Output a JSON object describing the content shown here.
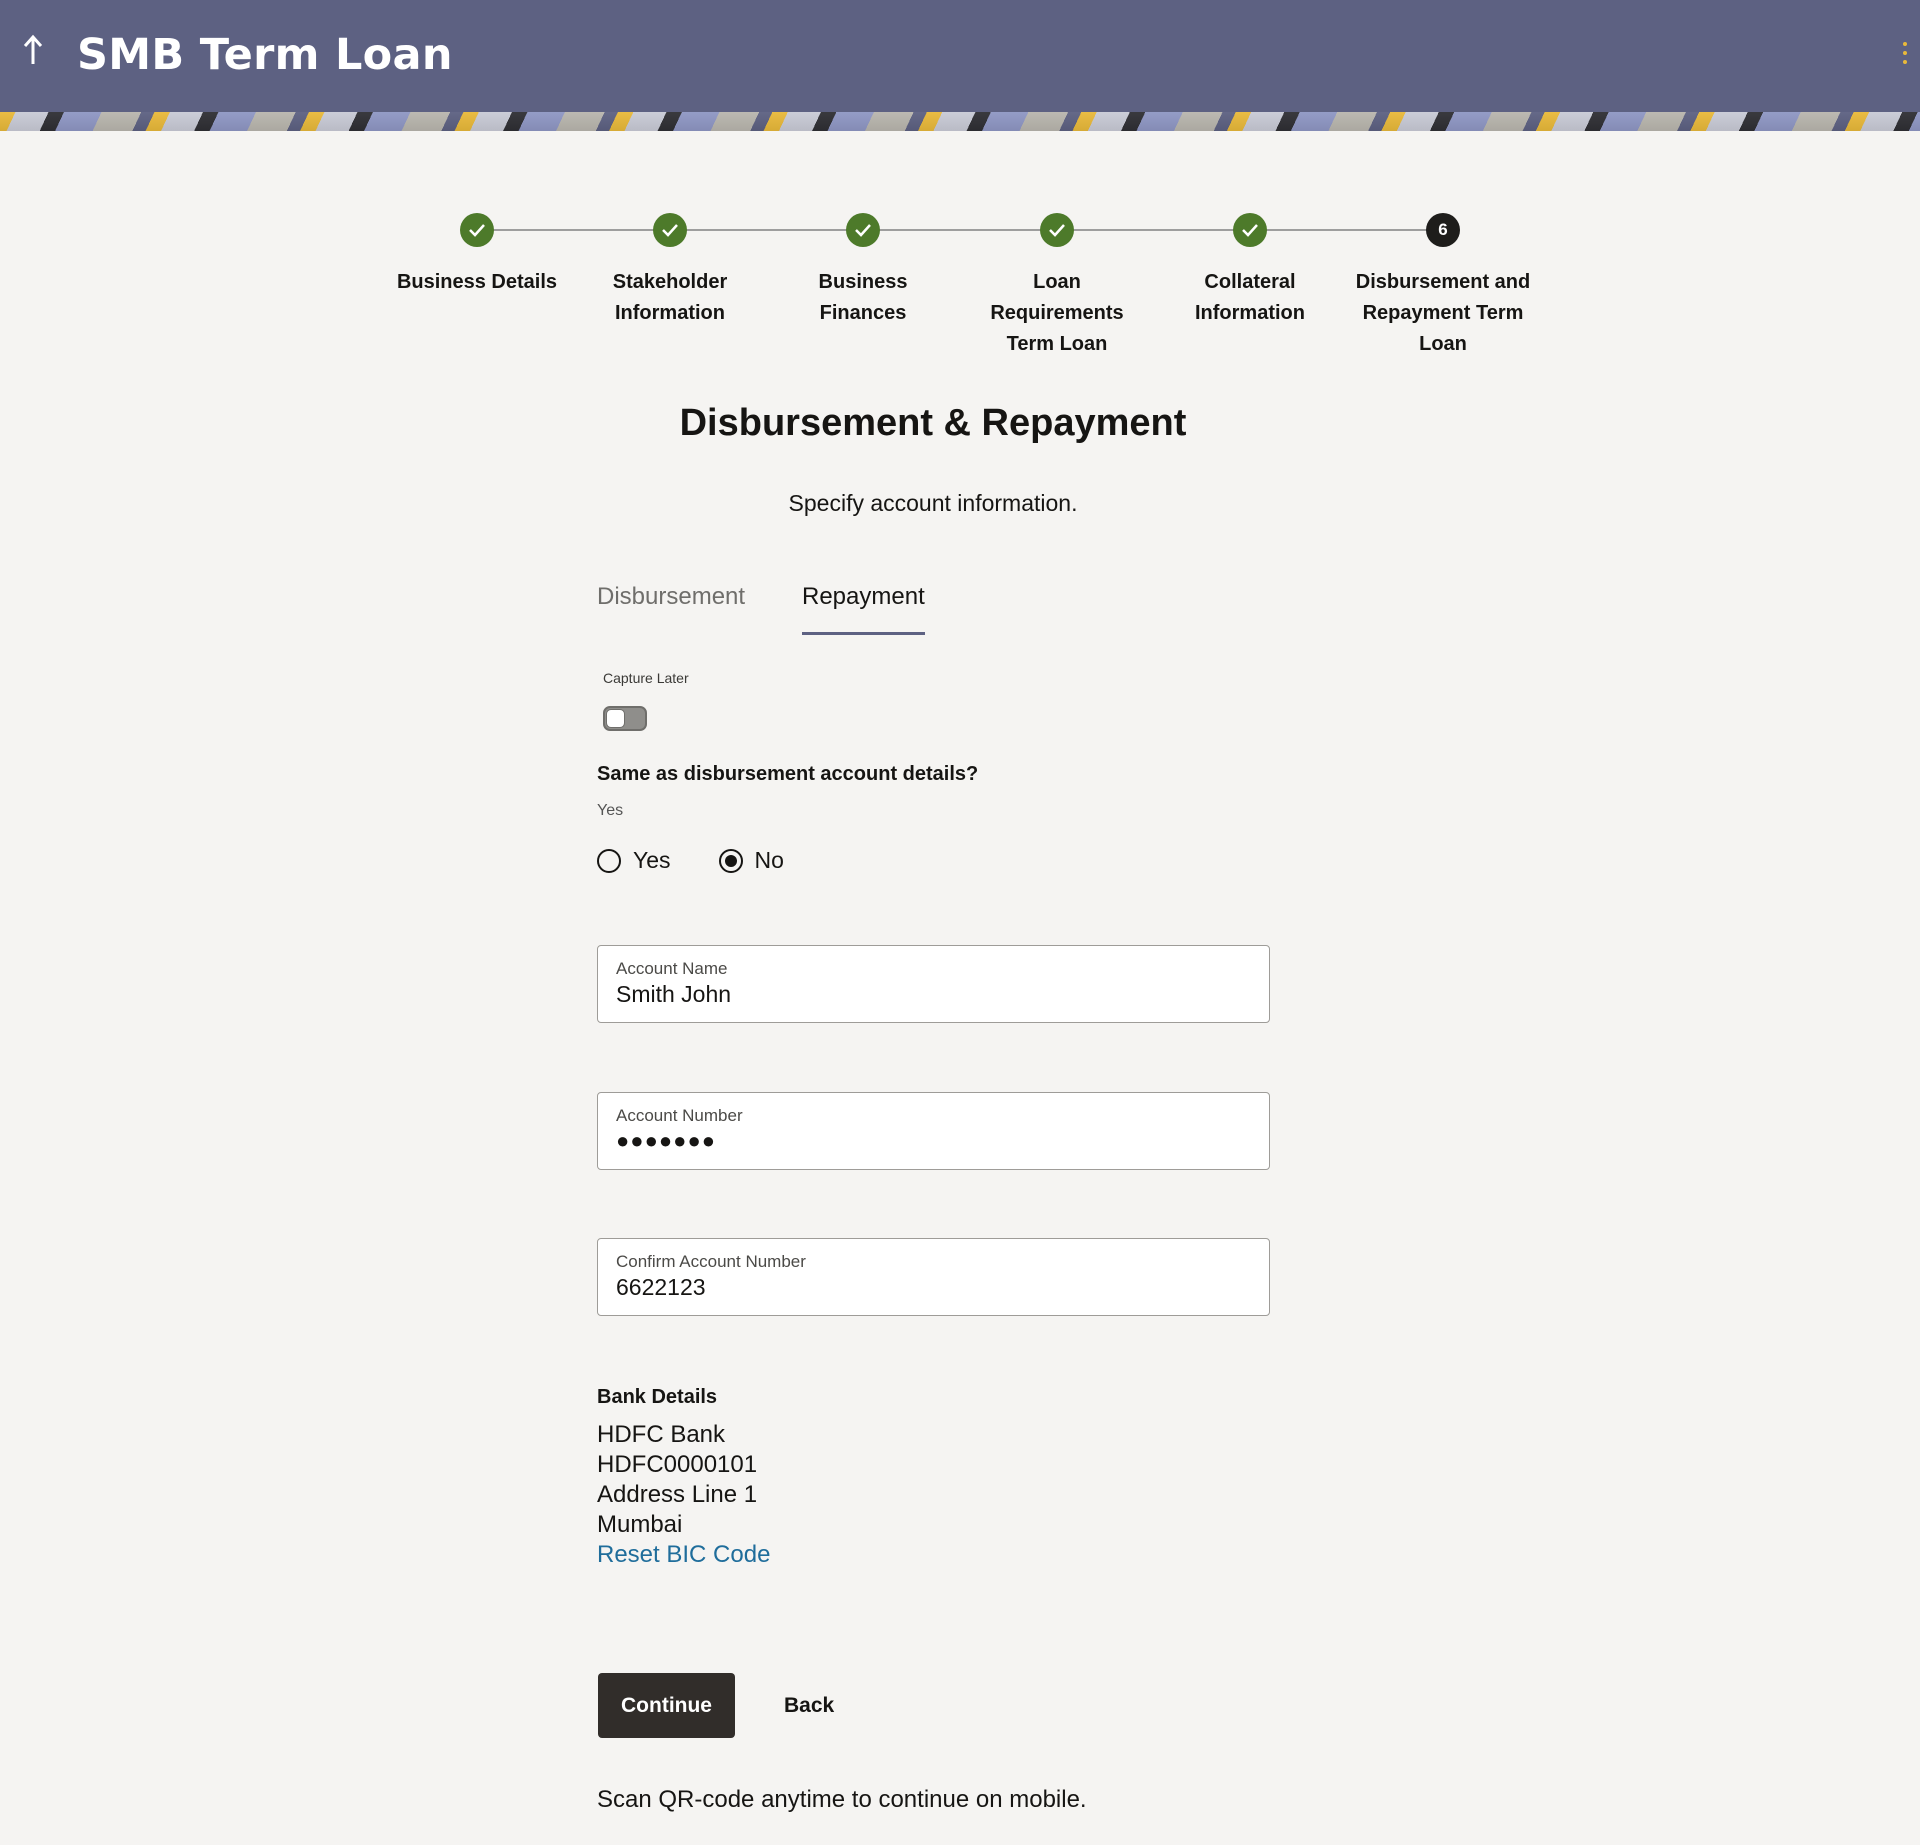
{
  "header": {
    "title": "SMB Term Loan",
    "back_icon": "up-arrow-icon",
    "menu_icon": "kebab-menu-icon",
    "accent_color": "#e9b93a",
    "bg_color": "#5d6182"
  },
  "stepper": {
    "steps": [
      {
        "label": "Business Details",
        "status": "complete"
      },
      {
        "label": "Stakeholder Information",
        "status": "complete"
      },
      {
        "label": "Business Finances",
        "status": "complete"
      },
      {
        "label": "Loan Requirements Term Loan",
        "status": "complete"
      },
      {
        "label": "Collateral Information",
        "status": "complete"
      },
      {
        "label": "Disbursement and Repayment Term Loan",
        "status": "current",
        "number": "6"
      }
    ],
    "complete_color": "#4d7a2a",
    "current_color": "#1e1d1b"
  },
  "page": {
    "title": "Disbursement & Repayment",
    "subtitle": "Specify account information."
  },
  "tabs": [
    {
      "label": "Disbursement",
      "active": false
    },
    {
      "label": "Repayment",
      "active": true
    }
  ],
  "capture_later": {
    "label": "Capture Later",
    "on": false
  },
  "same_as_disbursement": {
    "question": "Same as disbursement account details?",
    "hint": "Yes",
    "options": [
      {
        "label": "Yes",
        "checked": false
      },
      {
        "label": "No",
        "checked": true
      }
    ]
  },
  "fields": {
    "account_name": {
      "label": "Account Name",
      "value": "Smith John"
    },
    "account_number": {
      "label": "Account Number",
      "value": "●●●●●●●"
    },
    "confirm_account_number": {
      "label": "Confirm Account Number",
      "value": "6622123"
    }
  },
  "bank_details": {
    "title": "Bank Details",
    "bank_name": "HDFC Bank",
    "bic_code": "HDFC0000101",
    "address": "Address Line 1",
    "city": "Mumbai",
    "reset_link": "Reset BIC Code"
  },
  "actions": {
    "continue_label": "Continue",
    "back_label": "Back"
  },
  "footer": {
    "qr_note": "Scan QR-code anytime to continue on mobile."
  }
}
